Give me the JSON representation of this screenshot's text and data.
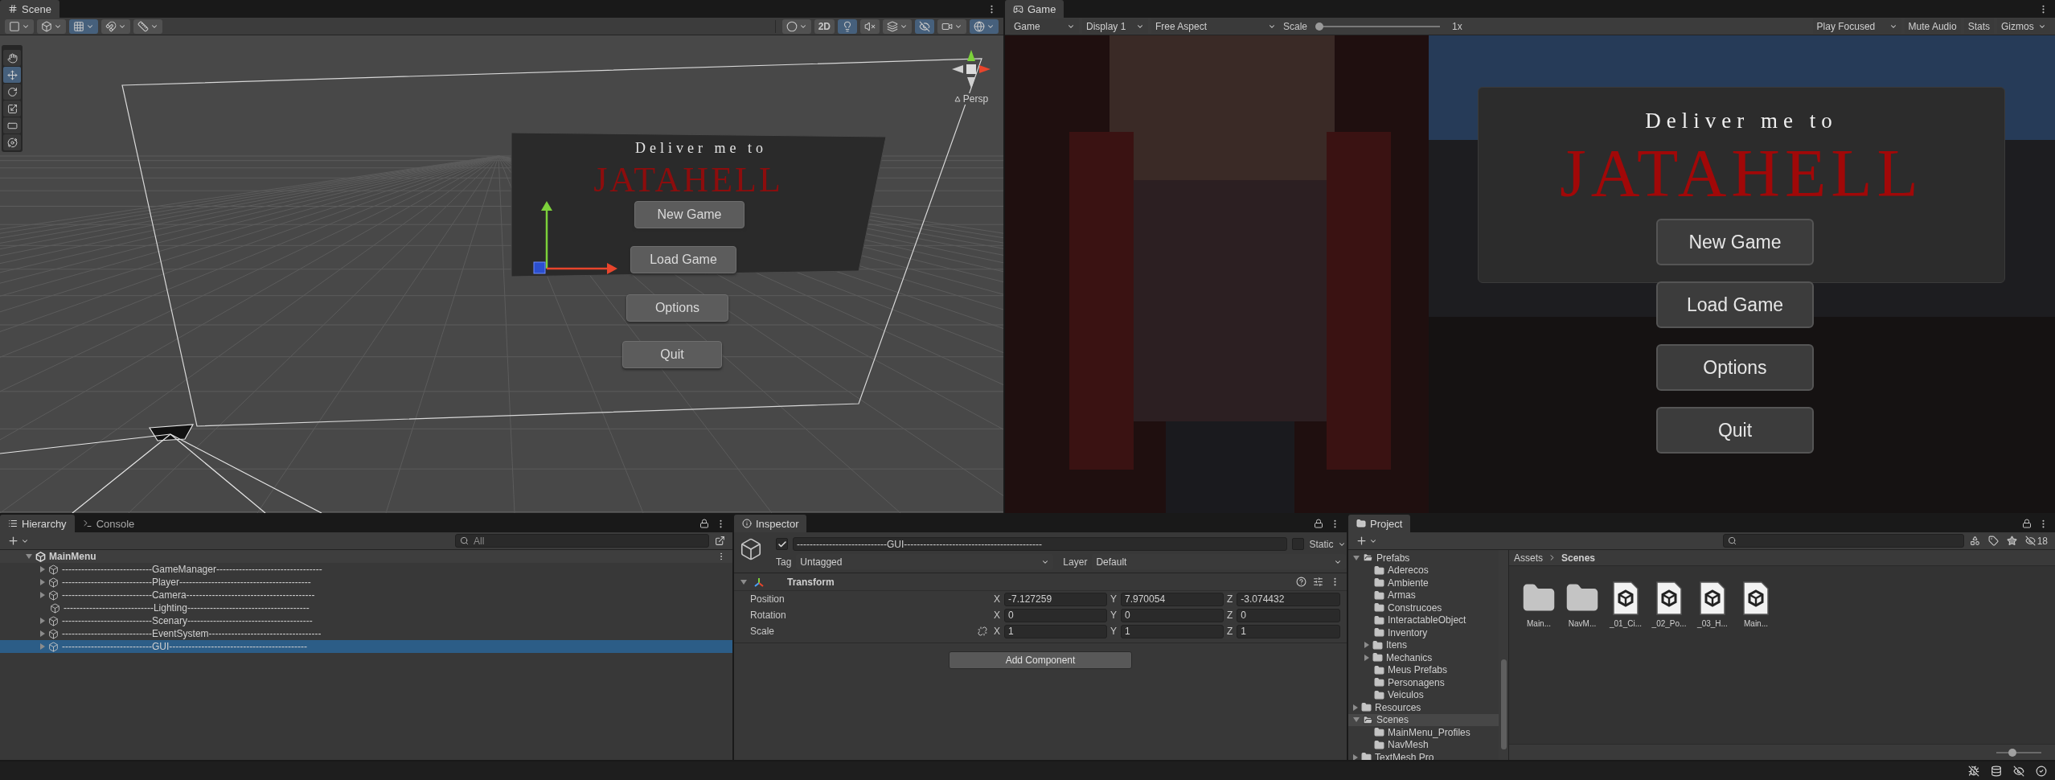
{
  "scene": {
    "tab": "Scene",
    "toolbar_left": [
      {
        "kind": "draw-mode",
        "on": false,
        "dropdown": true
      },
      {
        "kind": "shading",
        "on": false,
        "dropdown": true
      },
      {
        "kind": "grid",
        "on": true,
        "dropdown": true
      },
      {
        "kind": "snap",
        "on": false,
        "dropdown": true
      },
      {
        "kind": "increment",
        "on": false,
        "dropdown": true
      }
    ],
    "toolbar_right": [
      {
        "kind": "shading-sphere",
        "on": false,
        "dropdown": true
      },
      {
        "kind": "dimension",
        "label": "2D",
        "on": false,
        "dropdown": false
      },
      {
        "kind": "lighting",
        "on": true,
        "dropdown": false
      },
      {
        "kind": "audio",
        "on": false,
        "dropdown": false
      },
      {
        "kind": "effects",
        "on": false,
        "dropdown": true
      },
      {
        "kind": "visibility",
        "on": true,
        "dropdown": false
      },
      {
        "kind": "camera",
        "on": false,
        "dropdown": true
      },
      {
        "kind": "gizmos",
        "on": true,
        "dropdown": true
      }
    ],
    "tools": [
      {
        "kind": "hand",
        "selected": false
      },
      {
        "kind": "move",
        "selected": true
      },
      {
        "kind": "rotate",
        "selected": false
      },
      {
        "kind": "scale",
        "selected": false
      },
      {
        "kind": "rect",
        "selected": false
      },
      {
        "kind": "transform",
        "selected": false
      }
    ],
    "view_label": "Persp",
    "menu": {
      "subtitle": "Deliver me to",
      "title": "JATAHELL",
      "buttons": [
        "New Game",
        "Load Game",
        "Options",
        "Quit"
      ]
    }
  },
  "game": {
    "tab": "Game",
    "toolbar": {
      "mode": "Game",
      "display": "Display 1",
      "aspect": "Free Aspect",
      "scale_label": "Scale",
      "scale": {
        "level": 0
      },
      "scale_value": "1x",
      "play_mode": "Play Focused",
      "mute_audio": "Mute Audio",
      "stats": "Stats",
      "gizmos": "Gizmos"
    },
    "menu": {
      "subtitle": "Deliver me to",
      "title": "JATAHELL",
      "buttons": [
        "New Game",
        "Load Game",
        "Options",
        "Quit"
      ]
    }
  },
  "hierarchy": {
    "tabs": [
      {
        "label": "Hierarchy",
        "kind": "list",
        "selected": true
      },
      {
        "label": "Console",
        "kind": "console",
        "selected": false
      }
    ],
    "search": {
      "placeholder": "All"
    },
    "root": {
      "label": "MainMenu",
      "expandable": true,
      "expanded": true,
      "children": [
        {
          "label": "----------------------------GameManager---------------------------------",
          "expandable": true,
          "expanded": false,
          "selected": false
        },
        {
          "label": "----------------------------Player-----------------------------------------",
          "expandable": true,
          "expanded": false,
          "selected": false
        },
        {
          "label": "----------------------------Camera----------------------------------------",
          "expandable": true,
          "expanded": false,
          "selected": false
        },
        {
          "label": "----------------------------Lighting--------------------------------------",
          "expandable": false,
          "selected": false
        },
        {
          "label": "----------------------------Scenary---------------------------------------",
          "expandable": true,
          "expanded": false,
          "selected": false
        },
        {
          "label": "----------------------------EventSystem-----------------------------------",
          "expandable": true,
          "expanded": false,
          "selected": false
        },
        {
          "label": "----------------------------GUI-------------------------------------------",
          "expandable": true,
          "expanded": false,
          "selected": true
        }
      ]
    }
  },
  "inspector": {
    "tab": "Inspector",
    "object": {
      "active": true,
      "name": "----------------------------GUI-------------------------------------------",
      "static_label": "Static",
      "static": false,
      "tag_label": "Tag",
      "tag": "Untagged",
      "layer_label": "Layer",
      "layer": "Default"
    },
    "component": {
      "title": "Transform",
      "expanded": true,
      "rows": [
        {
          "label": "Position",
          "kind": "vector",
          "values": [
            {
              "axis": "X",
              "value": "-7.127259"
            },
            {
              "axis": "Y",
              "value": "7.970054"
            },
            {
              "axis": "Z",
              "value": "-3.074432"
            }
          ]
        },
        {
          "label": "Rotation",
          "kind": "vector",
          "values": [
            {
              "axis": "X",
              "value": "0"
            },
            {
              "axis": "Y",
              "value": "0"
            },
            {
              "axis": "Z",
              "value": "0"
            }
          ]
        },
        {
          "label": "Scale",
          "kind": "scale",
          "values": [
            {
              "axis": "X",
              "value": "1"
            },
            {
              "axis": "Y",
              "value": "1"
            },
            {
              "axis": "Z",
              "value": "1"
            }
          ]
        }
      ]
    },
    "add_button": "Add Component"
  },
  "project": {
    "tab": "Project",
    "hidden_count": "18",
    "tree": [
      {
        "label": "Prefabs",
        "expandable": true,
        "expanded": true,
        "selected": false,
        "children": [
          {
            "label": "Aderecos",
            "expandable": false,
            "expanded": false,
            "selected": false
          },
          {
            "label": "Ambiente",
            "expandable": false,
            "expanded": false,
            "selected": false
          },
          {
            "label": "Armas",
            "expandable": false,
            "expanded": false,
            "selected": false
          },
          {
            "label": "Construcoes",
            "expandable": false,
            "expanded": false,
            "selected": false
          },
          {
            "label": "InteractableObject",
            "expandable": false,
            "expanded": false,
            "selected": false
          },
          {
            "label": "Inventory",
            "expandable": false,
            "expanded": false,
            "selected": false
          },
          {
            "label": "Itens",
            "expandable": true,
            "expanded": false,
            "selected": false
          },
          {
            "label": "Mechanics",
            "expandable": true,
            "expanded": false,
            "selected": false
          },
          {
            "label": "Meus Prefabs",
            "expandable": false,
            "expanded": false,
            "selected": false
          },
          {
            "label": "Personagens",
            "expandable": false,
            "expanded": false,
            "selected": false
          },
          {
            "label": "Veiculos",
            "expandable": false,
            "expanded": false,
            "selected": false
          }
        ]
      },
      {
        "label": "Resources",
        "expandable": true,
        "expanded": false,
        "selected": false
      },
      {
        "label": "Scenes",
        "expandable": true,
        "expanded": true,
        "selected": true,
        "children": [
          {
            "label": "MainMenu_Profiles",
            "expandable": false,
            "expanded": false,
            "selected": false
          },
          {
            "label": "NavMesh",
            "expandable": false,
            "expanded": false,
            "selected": false
          }
        ]
      },
      {
        "label": "TextMesh Pro",
        "expandable": true,
        "expanded": false,
        "selected": false
      }
    ],
    "breadcrumb": [
      "Assets",
      "Scenes"
    ],
    "icon_size": {
      "level": 0.35
    },
    "items": [
      {
        "label": "Main...",
        "kind": "folder"
      },
      {
        "label": "NavM...",
        "kind": "folder"
      },
      {
        "label": "_01_Ci...",
        "kind": "scene"
      },
      {
        "label": "_02_Po...",
        "kind": "scene"
      },
      {
        "label": "_03_H...",
        "kind": "scene"
      },
      {
        "label": "Main...",
        "kind": "scene"
      }
    ]
  }
}
